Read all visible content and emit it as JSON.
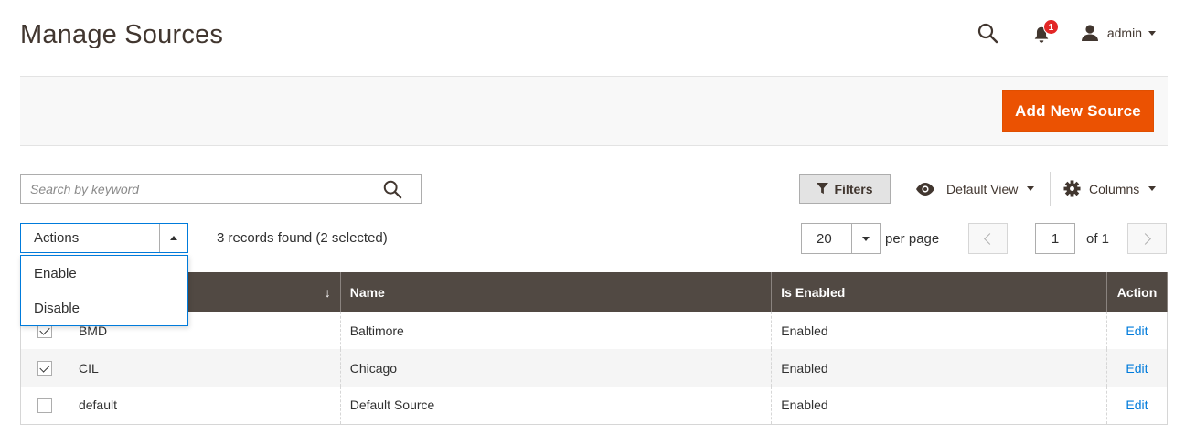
{
  "header": {
    "title": "Manage Sources",
    "notifications_count": "1",
    "user_name": "admin"
  },
  "action_bar": {
    "add_button_label": "Add New Source"
  },
  "toolbar": {
    "search_placeholder": "Search by keyword",
    "filters_label": "Filters",
    "view_label": "Default View",
    "columns_label": "Columns"
  },
  "mass_actions": {
    "label": "Actions",
    "options": [
      "Enable",
      "Disable"
    ]
  },
  "records_text": "3 records found (2 selected)",
  "pagination": {
    "per_page_value": "20",
    "per_page_label": "per page",
    "current_page": "1",
    "total_label": "of 1"
  },
  "grid": {
    "sort_indicator": "↓",
    "columns": {
      "code": "",
      "name": "Name",
      "is_enabled": "Is Enabled",
      "action": "Action"
    },
    "rows": [
      {
        "checked": true,
        "code": "BMD",
        "name": "Baltimore",
        "is_enabled": "Enabled",
        "action": "Edit"
      },
      {
        "checked": true,
        "code": "CIL",
        "name": "Chicago",
        "is_enabled": "Enabled",
        "action": "Edit"
      },
      {
        "checked": false,
        "code": "default",
        "name": "Default Source",
        "is_enabled": "Enabled",
        "action": "Edit"
      }
    ]
  },
  "colors": {
    "accent": "#eb5202",
    "header_bg": "#514943",
    "link": "#007bdb",
    "badge": "#e22626"
  },
  "icons": {
    "search": "search-icon",
    "notifications": "bell-icon",
    "user": "user-icon",
    "filters": "funnel-icon",
    "view": "eye-icon",
    "columns": "gear-icon"
  }
}
